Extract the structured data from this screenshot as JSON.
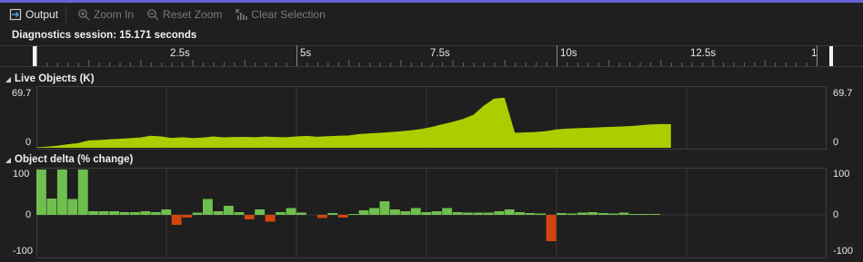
{
  "toolbar": {
    "output_label": "Output",
    "zoom_in_label": "Zoom In",
    "reset_zoom_label": "Reset Zoom",
    "clear_selection_label": "Clear Selection"
  },
  "session": {
    "label": "Diagnostics session: 15.171 seconds"
  },
  "ruler": {
    "ticks": [
      "2.5s",
      "5s",
      "7.5s",
      "10s",
      "12.5s",
      "1"
    ],
    "tick_values": [
      2.5,
      5,
      7.5,
      10,
      12.5,
      15
    ],
    "duration_s": 15.171
  },
  "colors": {
    "accent": "#6b5fd6",
    "live_fill": "#aecd00",
    "delta_pos": "#6fbf4f",
    "delta_neg": "#d2460d"
  },
  "live_objects": {
    "title": "Live Objects (K)",
    "y_max_label_left": "69.7",
    "y_max_label_right": "69.7",
    "y_min_label_left": "0",
    "y_min_label_right": "0"
  },
  "object_delta": {
    "title": "Object delta (% change)",
    "y_top_left": "100",
    "y_mid_left": "0",
    "y_bot_left": "-100",
    "y_top_right": "100",
    "y_mid_right": "0",
    "y_bot_right": "-100"
  },
  "chart_data": [
    {
      "type": "area",
      "title": "Live Objects (K)",
      "ylim": [
        0,
        69.7
      ],
      "x": [
        0.0,
        0.2,
        0.4,
        0.6,
        0.8,
        1.0,
        1.2,
        1.4,
        1.6,
        1.8,
        2.0,
        2.2,
        2.4,
        2.6,
        2.8,
        3.0,
        3.2,
        3.4,
        3.6,
        3.8,
        4.0,
        4.2,
        4.4,
        4.6,
        4.8,
        5.0,
        5.2,
        5.4,
        5.6,
        5.8,
        6.0,
        6.2,
        6.4,
        6.6,
        6.8,
        7.0,
        7.2,
        7.4,
        7.6,
        7.8,
        8.0,
        8.2,
        8.4,
        8.6,
        8.8,
        9.0,
        9.2,
        9.4,
        9.6,
        9.8,
        10.0,
        10.2,
        10.4,
        10.6,
        10.8,
        11.0,
        11.2,
        11.4,
        11.6,
        11.8,
        12.0,
        12.2
      ],
      "values": [
        0.5,
        1.3,
        2.5,
        4.2,
        5.5,
        8.8,
        9.3,
        10.2,
        10.8,
        11.5,
        12.4,
        14.5,
        13.6,
        11.8,
        12.6,
        11.6,
        12.2,
        13.6,
        12.5,
        13.0,
        13.1,
        12.6,
        13.5,
        13.0,
        12.6,
        13.6,
        14.3,
        13.2,
        13.8,
        14.4,
        14.7,
        16.4,
        17.3,
        18.0,
        18.7,
        19.7,
        21.0,
        22.6,
        25.0,
        28.2,
        31.0,
        34.5,
        39.5,
        50.5,
        59.0,
        60.1,
        18.0,
        18.5,
        19.0,
        20.0,
        22.0,
        23.0,
        23.5,
        24.0,
        24.5,
        25.0,
        25.5,
        26.0,
        27.0,
        28.0,
        28.4,
        28.4
      ],
      "xlim": [
        0,
        15.171
      ]
    },
    {
      "type": "bar",
      "title": "Object delta (% change)",
      "ylim": [
        -100,
        100
      ],
      "x": [
        0.2,
        0.4,
        0.6,
        0.8,
        1.0,
        1.2,
        1.4,
        1.6,
        1.8,
        2.0,
        2.2,
        2.4,
        2.6,
        2.8,
        3.0,
        3.2,
        3.4,
        3.6,
        3.8,
        4.0,
        4.2,
        4.4,
        4.6,
        4.8,
        5.0,
        5.2,
        5.4,
        5.6,
        5.8,
        6.0,
        6.2,
        6.4,
        6.6,
        6.8,
        7.0,
        7.2,
        7.4,
        7.6,
        7.8,
        8.0,
        8.2,
        8.4,
        8.6,
        8.8,
        9.0,
        9.2,
        9.4,
        9.6,
        9.8,
        10.0,
        10.2,
        10.4,
        10.6,
        10.8,
        11.0,
        11.2,
        11.4,
        11.6,
        11.8,
        12.0
      ],
      "values": [
        100,
        36,
        100,
        35,
        100,
        8,
        8,
        8,
        6,
        6,
        8,
        6,
        12,
        -22,
        -6,
        5,
        35,
        8,
        20,
        6,
        -10,
        12,
        -15,
        6,
        15,
        5,
        0,
        -7,
        4,
        -6,
        2,
        10,
        15,
        30,
        12,
        8,
        15,
        6,
        8,
        15,
        6,
        5,
        5,
        5,
        8,
        12,
        6,
        4,
        3,
        -58,
        4,
        3,
        5,
        6,
        4,
        3,
        5,
        2,
        2,
        2
      ],
      "xlim": [
        0,
        15.171
      ]
    }
  ]
}
